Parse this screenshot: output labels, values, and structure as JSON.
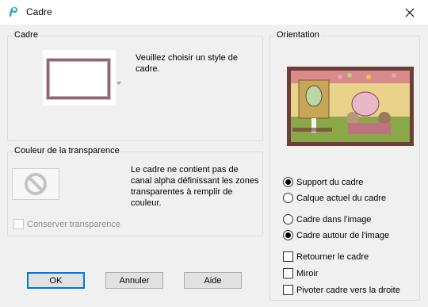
{
  "window": {
    "title": "Cadre"
  },
  "frame_group": {
    "label": "Cadre",
    "description": "Veuillez choisir un style de cadre."
  },
  "transparency_group": {
    "label": "Couleur de la transparence",
    "description": "Le cadre ne contient pas de canal alpha définissant les zones transparentes à remplir de couleur.",
    "keep_transparency_label": "Conserver transparence",
    "keep_transparency_checked": false
  },
  "orientation_group": {
    "label": "Orientation",
    "radios_a": [
      {
        "label": "Support du cadre",
        "checked": true
      },
      {
        "label": "Calque actuel du cadre",
        "checked": false
      }
    ],
    "radios_b": [
      {
        "label": "Cadre dans l'image",
        "checked": false
      },
      {
        "label": "Cadre autour de l'image",
        "checked": true
      }
    ],
    "checkboxes": [
      {
        "label": "Retourner le cadre",
        "checked": false
      },
      {
        "label": "Miroir",
        "checked": false
      },
      {
        "label": "Pivoter cadre vers la droite",
        "checked": false
      }
    ]
  },
  "buttons": {
    "ok": "OK",
    "cancel": "Annuler",
    "help": "Aide"
  },
  "colors": {
    "frame_border": "#8e6970",
    "focus_blue": "#0078d7",
    "dialog_bg": "#f0f0f0"
  }
}
